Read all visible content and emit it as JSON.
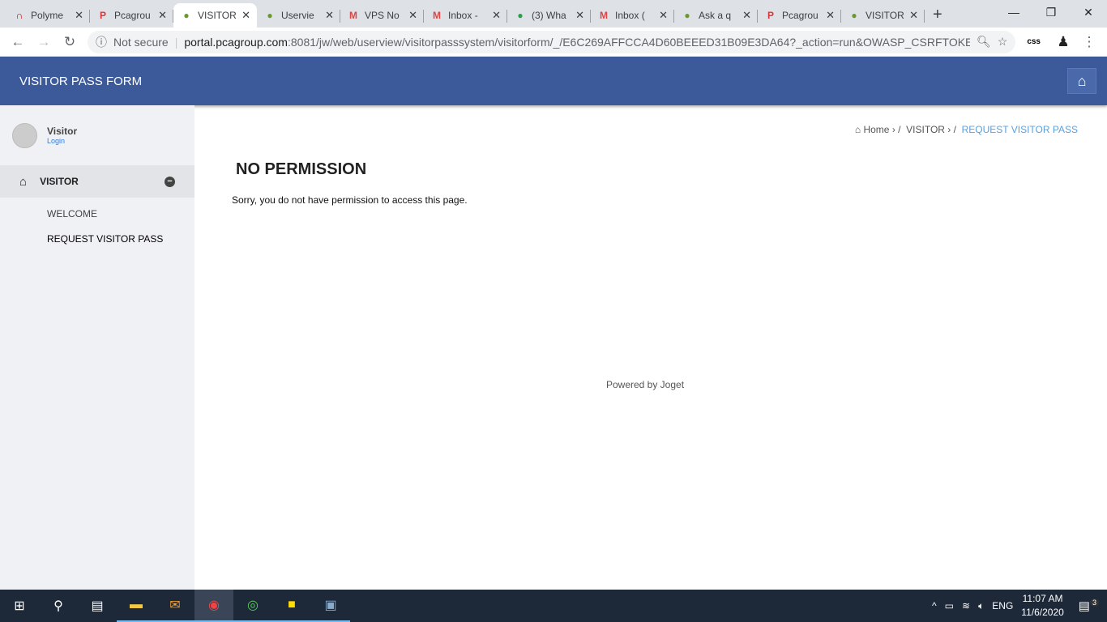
{
  "browser": {
    "tabs": [
      {
        "title": "Polyme",
        "icon": "redhat-icon",
        "color": "#c00"
      },
      {
        "title": "Pcagrou",
        "icon": "p-icon",
        "color": "#d33"
      },
      {
        "title": "VISITOR",
        "icon": "joget-icon",
        "color": "#6a9a2a",
        "active": true
      },
      {
        "title": "Uservie",
        "icon": "joget-icon",
        "color": "#6a9a2a"
      },
      {
        "title": "VPS No",
        "icon": "gmail-icon",
        "color": "#d44"
      },
      {
        "title": "Inbox -",
        "icon": "gmail-icon",
        "color": "#d44"
      },
      {
        "title": "(3) Wha",
        "icon": "whatsapp-icon",
        "color": "#25a244"
      },
      {
        "title": "Inbox (",
        "icon": "gmail-icon",
        "color": "#d44"
      },
      {
        "title": "Ask a q",
        "icon": "joget-icon",
        "color": "#6a9a2a"
      },
      {
        "title": "Pcagrou",
        "icon": "p-icon",
        "color": "#d33"
      },
      {
        "title": "VISITOR",
        "icon": "joget-icon",
        "color": "#6a9a2a"
      }
    ],
    "not_secure": "Not secure",
    "url_host": "portal.pcagroup.com",
    "url_rest": ":8081/jw/web/userview/visitorpasssystem/visitorform/_/E6C269AFFCCA4D60BEEED31B09E3DA64?_action=run&OWASP_CSRFTOKE...",
    "ext": "css"
  },
  "app": {
    "title": "VISITOR PASS FORM"
  },
  "sidebar": {
    "user": "Visitor",
    "login": "Login",
    "menu": "VISITOR",
    "items": [
      "WELCOME",
      "REQUEST VISITOR PASS"
    ]
  },
  "breadcrumb": {
    "home": "Home",
    "visitor": "VISITOR",
    "current": "REQUEST VISITOR PASS"
  },
  "main": {
    "heading": "NO PERMISSION",
    "message": "Sorry, you do not have permission to access this page.",
    "powered": "Powered by Joget"
  },
  "taskbar": {
    "lang": "ENG",
    "time": "11:07 AM",
    "date": "11/6/2020",
    "notifications": "3"
  }
}
